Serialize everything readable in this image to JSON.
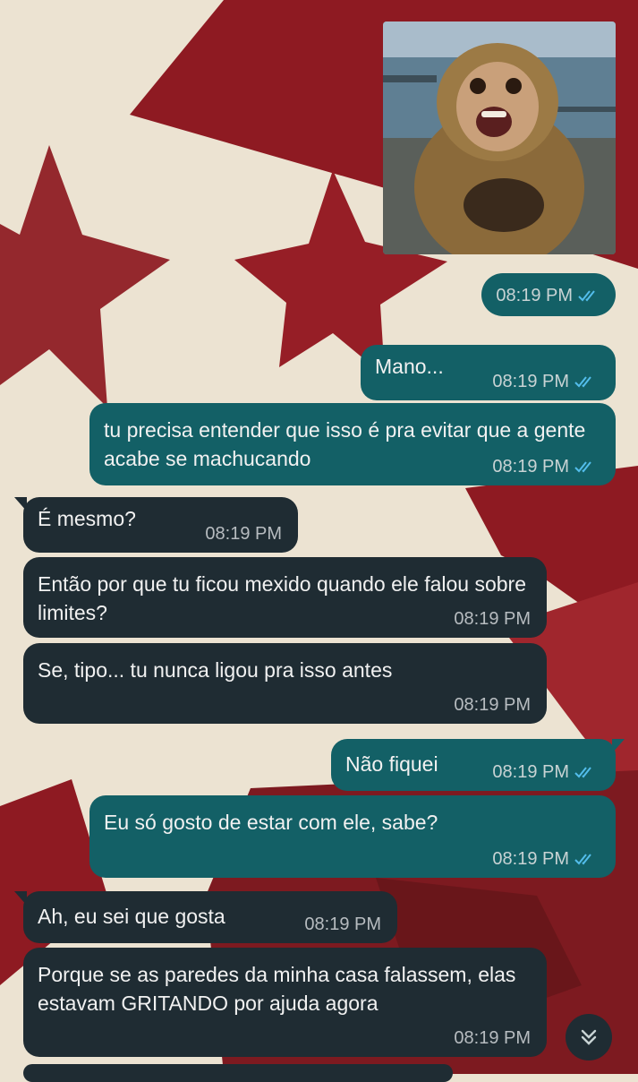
{
  "chat": {
    "image_message": {
      "time": "08:19 PM",
      "status": "read",
      "image_subject": "surprised monkey photo"
    },
    "messages": [
      {
        "side": "out",
        "text": "Mano...",
        "time": "08:19 PM",
        "status": "read"
      },
      {
        "side": "out",
        "text": "tu precisa entender que isso é pra evitar que a gente acabe se machucando",
        "time": "08:19 PM",
        "status": "read"
      },
      {
        "side": "in",
        "text": "É mesmo?",
        "time": "08:19 PM"
      },
      {
        "side": "in",
        "text": "Então por que tu ficou mexido quando ele falou sobre limites?",
        "time": "08:19 PM"
      },
      {
        "side": "in",
        "text": "Se, tipo... tu nunca ligou pra isso antes",
        "time": "08:19 PM"
      },
      {
        "side": "out",
        "text": "Não fiquei",
        "time": "08:19 PM",
        "status": "read"
      },
      {
        "side": "out",
        "text": "Eu só gosto de estar com ele, sabe?",
        "time": "08:19 PM",
        "status": "read"
      },
      {
        "side": "in",
        "text": "Ah, eu sei que gosta",
        "time": "08:19 PM"
      },
      {
        "side": "in",
        "text": "Porque se as paredes da minha casa falassem, elas estavam GRITANDO por ajuda agora",
        "time": "08:19 PM"
      }
    ]
  },
  "colors": {
    "outgoing_bubble": "#136066",
    "incoming_bubble": "#1f2c33",
    "read_ticks": "#53bdeb",
    "wallpaper_bg": "#ece3d2",
    "wallpaper_red": "#8e1a22"
  },
  "icons": {
    "scroll_down": "double-chevron-down-icon",
    "read_receipt": "double-check-icon"
  }
}
